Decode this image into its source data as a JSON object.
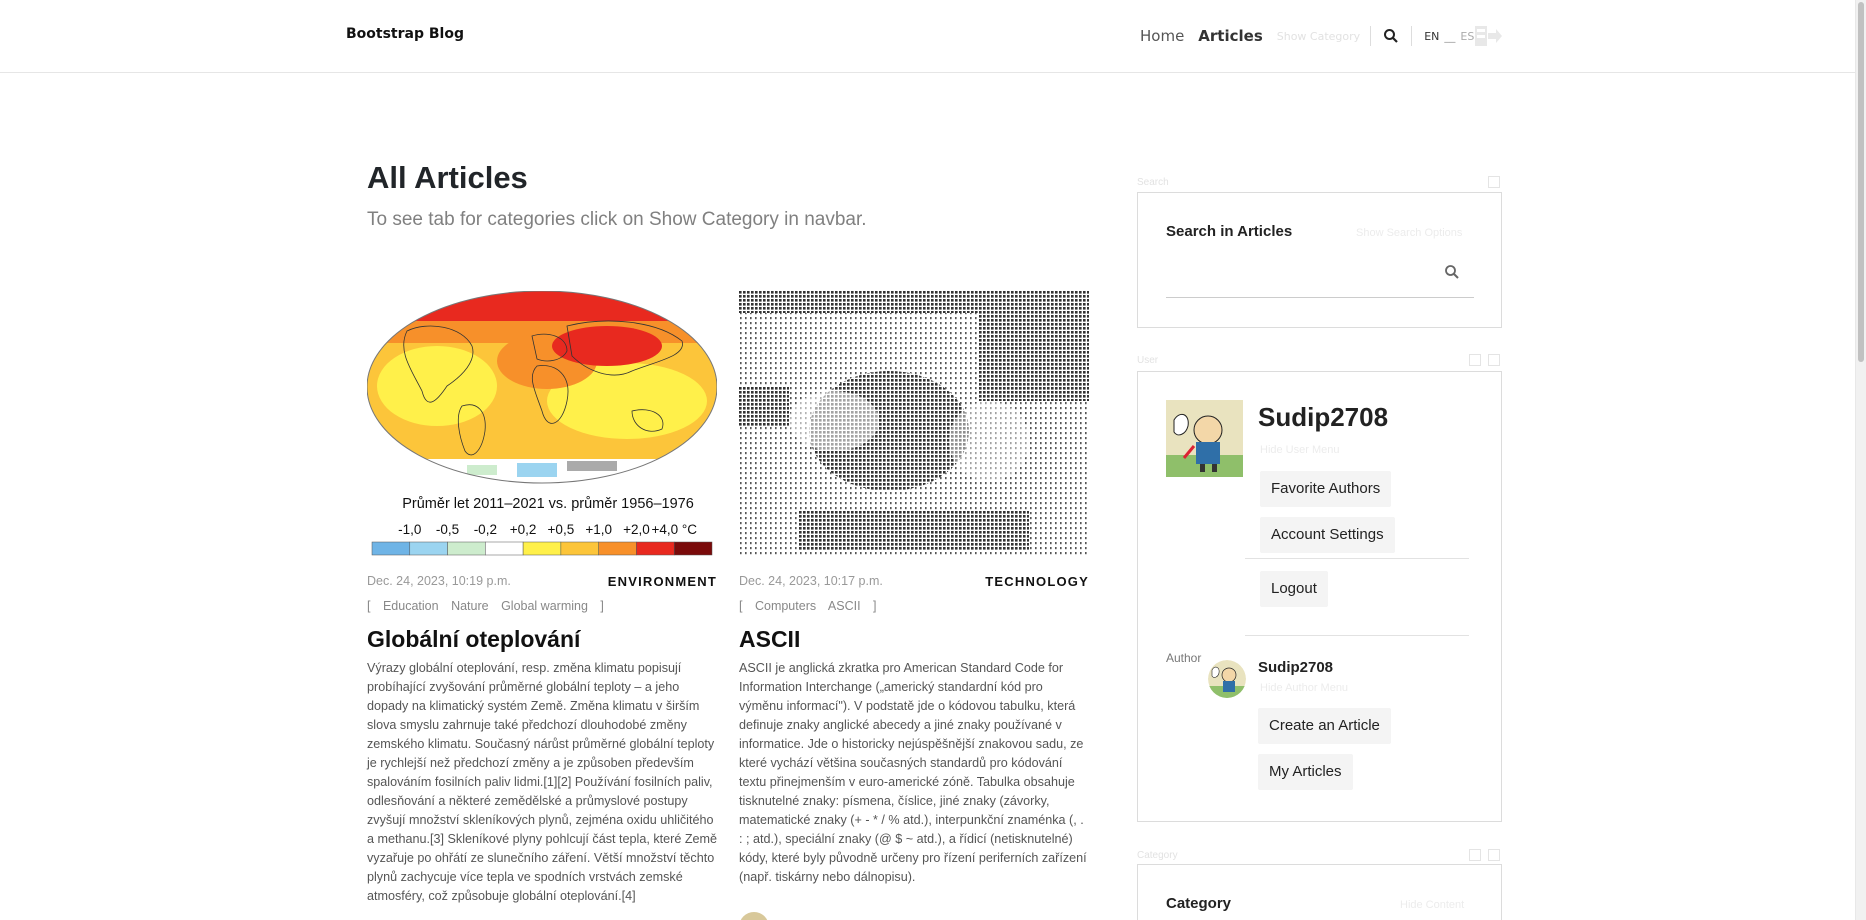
{
  "navbar": {
    "brand": "Bootstrap Blog",
    "links": [
      "Home",
      "Articles"
    ],
    "show_category": "Show Category",
    "lang_en": "EN",
    "lang_sep": "__",
    "lang_es": "ES",
    "icons": [
      "search-icon",
      "logout-icon"
    ]
  },
  "main": {
    "title": "All Articles",
    "subtitle": "To see tab for categories click on Show Category in navbar.",
    "articles": [
      {
        "image_caption": "Průměr let 2011–2021 vs. průměr 1956–1976",
        "scale_labels": [
          "-1,0",
          "-0,5",
          "-0,2",
          "+0,2",
          "+0,5",
          "+1,0",
          "+2,0",
          "+4,0 °C"
        ],
        "scale_colors": [
          "#6fb4e6",
          "#9bd4f0",
          "#cdeccd",
          "#ffffff",
          "#fff04a",
          "#fcc53a",
          "#f7902a",
          "#e8291f",
          "#7a0a0a"
        ],
        "date": "Dec. 24, 2023, 10:19 p.m.",
        "category": "ENVIRONMENT",
        "tags": [
          "Education",
          "Nature",
          "Global warming"
        ],
        "title": "Globální oteplování",
        "text": "Výrazy globální oteplování, resp. změna klimatu popisují probíhající zvyšování průměrné globální teploty – a jeho dopady na klimatický systém Země. Změna klimatu v širším slova smyslu zahrnuje také předchozí dlouhodobé změny zemského klimatu. Současný nárůst průměrné globální teploty je rychlejší než předchozí změny a je způsoben především spalováním fosilních paliv lidmi.[1][2] Používání fosilních paliv, odlesňování a některé zemědělské a průmyslové postupy zvyšují množství skleníkových plynů, zejména oxidu uhličitého a methanu.[3] Skleníkové plyny pohlcují část tepla, které Země vyzařuje po ohřátí ze slunečního záření. Větší množství těchto plynů zachycuje více tepla ve spodních vrstvách zemské atmosféry, což způsobuje globální oteplování.[4]"
      },
      {
        "date": "Dec. 24, 2023, 10:17 p.m.",
        "category": "TECHNOLOGY",
        "tags": [
          "Computers",
          "ASCII"
        ],
        "title": "ASCII",
        "text": "ASCII je anglická zkratka pro American Standard Code for Information Interchange („americký standardní kód pro výměnu informací\"). V podstatě jde o kódovou tabulku, která definuje znaky anglické abecedy a jiné znaky používané v informatice. Jde o historicky nejúspěšnější znakovou sadu, ze které vychází většina současných standardů pro kódování textu přinejmenším v euro-americké zóně. Tabulka obsahuje tisknutelné znaky: písmena, číslice, jiné znaky (závorky, matematické znaky (+ - * / % atd.), interpunkční znaménka (, . : ; atd.), speciální znaky (@ $ ~ atd.), a řídicí (netisknutelné) kódy, které byly původně určeny pro řízení periferních zařízení (např. tiskárny nebo dálnopisu)."
      }
    ]
  },
  "sidebar": {
    "search": {
      "label": "Search",
      "title": "Search in Articles",
      "options_link": "Show Search Options"
    },
    "user": {
      "label": "User",
      "username": "Sudip2708",
      "hide_menu": "Hide User Menu",
      "buttons": [
        "Favorite Authors",
        "Account Settings",
        "Logout"
      ],
      "author_label": "Author",
      "author_name": "Sudip2708",
      "hide_author_menu": "Hide Author Menu",
      "author_buttons": [
        "Create an Article",
        "My Articles"
      ]
    },
    "category": {
      "label": "Category",
      "title": "Category",
      "hide_link": "Hide Content"
    }
  }
}
